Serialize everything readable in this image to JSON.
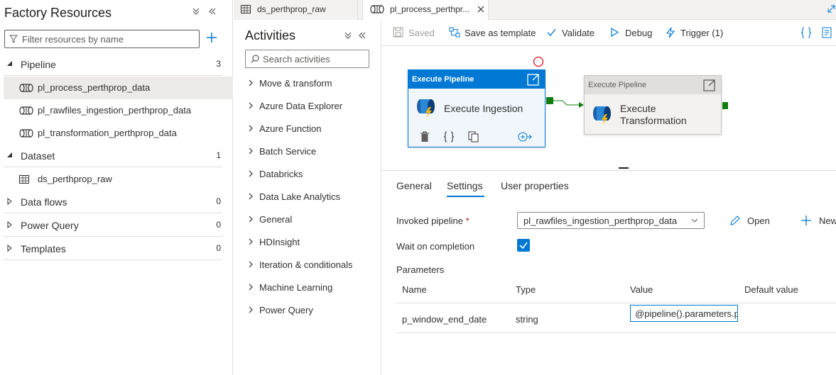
{
  "factory": {
    "title": "Factory Resources",
    "filter_placeholder": "Filter resources by name",
    "sections": [
      {
        "label": "Pipeline",
        "count": "3",
        "items": [
          "pl_process_perthprop_data",
          "pl_rawfiles_ingestion_perthprop_data",
          "pl_transformation_perthprop_data"
        ]
      },
      {
        "label": "Dataset",
        "count": "1",
        "items": [
          "ds_perthprop_raw"
        ]
      },
      {
        "label": "Data flows",
        "count": "0"
      },
      {
        "label": "Power Query",
        "count": "0"
      },
      {
        "label": "Templates",
        "count": "0"
      }
    ]
  },
  "tabs": [
    {
      "label": "ds_perthprop_raw"
    },
    {
      "label": "pl_process_perthpr..."
    }
  ],
  "activities": {
    "title": "Activities",
    "search_placeholder": "Search activities",
    "items": [
      "Move & transform",
      "Azure Data Explorer",
      "Azure Function",
      "Batch Service",
      "Databricks",
      "Data Lake Analytics",
      "General",
      "HDInsight",
      "Iteration & conditionals",
      "Machine Learning",
      "Power Query"
    ]
  },
  "toolbar": {
    "saved": "Saved",
    "save_template": "Save as template",
    "validate": "Validate",
    "debug": "Debug",
    "trigger": "Trigger (1)"
  },
  "canvas": {
    "node1": {
      "header": "Execute Pipeline",
      "name": "Execute Ingestion"
    },
    "node2": {
      "header": "Execute Pipeline",
      "name_line1": "Execute",
      "name_line2": "Transformation"
    }
  },
  "properties": {
    "tabs": [
      "General",
      "Settings",
      "User properties"
    ],
    "active_tab": "Settings",
    "invoked_pipeline_label": "Invoked pipeline",
    "required_mark": "*",
    "invoked_pipeline_value": "pl_rawfiles_ingestion_perthprop_data",
    "open_label": "Open",
    "new_label": "New",
    "wait_label": "Wait on completion",
    "wait_checked": true,
    "parameters_label": "Parameters",
    "columns": [
      "Name",
      "Type",
      "Value",
      "Default value"
    ],
    "rows": [
      {
        "name": "p_window_end_date",
        "type": "string",
        "value": "@pipeline().parameters.p_"
      }
    ]
  },
  "colors": {
    "accent": "#0078d4",
    "success": "#107c10",
    "error": "#e81123"
  }
}
